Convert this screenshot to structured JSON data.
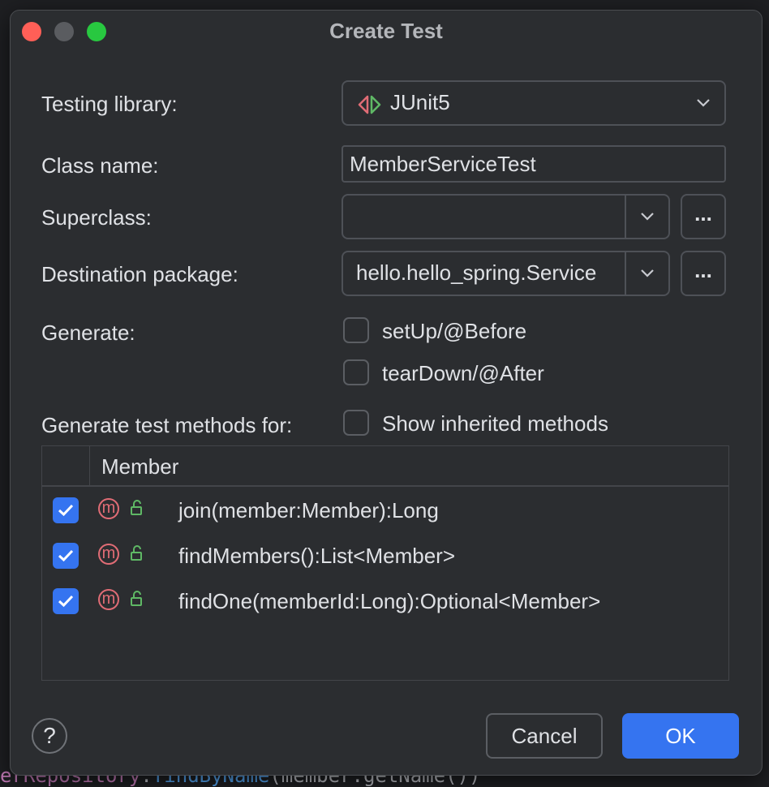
{
  "dialog": {
    "title": "Create Test",
    "testing_library": {
      "label": "Testing library:",
      "value": "JUnit5"
    },
    "class_name": {
      "label": "Class name:",
      "value": "MemberServiceTest"
    },
    "superclass": {
      "label": "Superclass:",
      "value": "",
      "browse": "..."
    },
    "destination_package": {
      "label": "Destination package:",
      "value": "hello.hello_spring.Service",
      "browse": "..."
    },
    "generate": {
      "label": "Generate:",
      "options": [
        {
          "label": "setUp/@Before",
          "checked": false
        },
        {
          "label": "tearDown/@After",
          "checked": false
        }
      ]
    },
    "methods_for": {
      "label": "Generate test methods for:",
      "show_inherited": {
        "label": "Show inherited methods",
        "checked": false
      }
    },
    "table": {
      "header": "Member",
      "rows": [
        {
          "checked": true,
          "icon": "m",
          "signature": "join(member:Member):Long"
        },
        {
          "checked": true,
          "icon": "m",
          "signature": "findMembers():List<Member>"
        },
        {
          "checked": true,
          "icon": "m",
          "signature": "findOne(memberId:Long):Optional<Member>"
        }
      ]
    },
    "help": "?",
    "cancel": "Cancel",
    "ok": "OK"
  },
  "colors": {
    "accent": "#3574f0",
    "method_icon": "#e06c75",
    "lock_icon": "#5fb865"
  }
}
